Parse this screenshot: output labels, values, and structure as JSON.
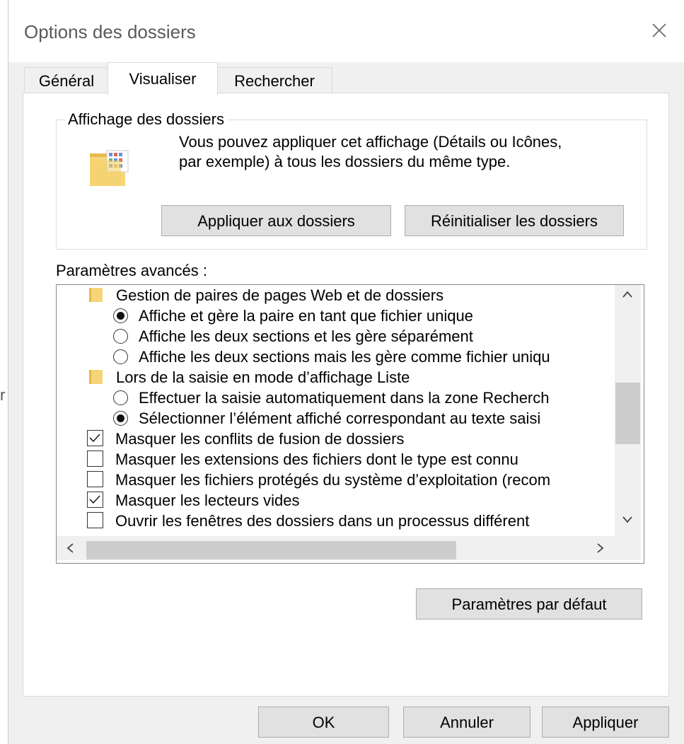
{
  "window": {
    "title": "Options des dossiers",
    "close_icon": "close-icon"
  },
  "tabs": [
    {
      "label": "Général",
      "active": false
    },
    {
      "label": "Visualiser",
      "active": true
    },
    {
      "label": "Rechercher",
      "active": false
    }
  ],
  "folder_views": {
    "title": "Affichage des dossiers",
    "description_line1": "Vous pouvez appliquer cet affichage (Détails ou Icônes,",
    "description_line2": "par exemple) à tous les dossiers du même type.",
    "apply_button": "Appliquer aux dossiers",
    "reset_button": "Réinitialiser les dossiers"
  },
  "advanced": {
    "label": "Paramètres avancés :",
    "items": [
      {
        "kind": "folder",
        "text": "Gestion de paires de pages Web et de dossiers"
      },
      {
        "kind": "radio",
        "checked": true,
        "text": "Affiche et gère la paire en tant que fichier unique"
      },
      {
        "kind": "radio",
        "checked": false,
        "text": "Affiche les deux sections et les gère séparément"
      },
      {
        "kind": "radio",
        "checked": false,
        "text": "Affiche les deux sections mais les gère comme fichier uniqu"
      },
      {
        "kind": "folder",
        "text": "Lors de la saisie en mode d’affichage Liste"
      },
      {
        "kind": "radio",
        "checked": false,
        "text": "Effectuer la saisie automatiquement dans la zone Recherch"
      },
      {
        "kind": "radio",
        "checked": true,
        "text": "Sélectionner l’élément affiché correspondant au texte saisi"
      },
      {
        "kind": "checkbox",
        "checked": true,
        "text": "Masquer les conflits de fusion de dossiers"
      },
      {
        "kind": "checkbox",
        "checked": false,
        "text": "Masquer les extensions des fichiers dont le type est connu"
      },
      {
        "kind": "checkbox",
        "checked": false,
        "text": "Masquer les fichiers protégés du système d’exploitation (recom"
      },
      {
        "kind": "checkbox",
        "checked": true,
        "text": "Masquer les lecteurs vides"
      },
      {
        "kind": "checkbox",
        "checked": false,
        "text": "Ouvrir les fenêtres des dossiers dans un processus différent"
      }
    ]
  },
  "defaults_button": "Paramètres par défaut",
  "footer": {
    "ok": "OK",
    "cancel": "Annuler",
    "apply": "Appliquer"
  },
  "edge_glyph": "r"
}
